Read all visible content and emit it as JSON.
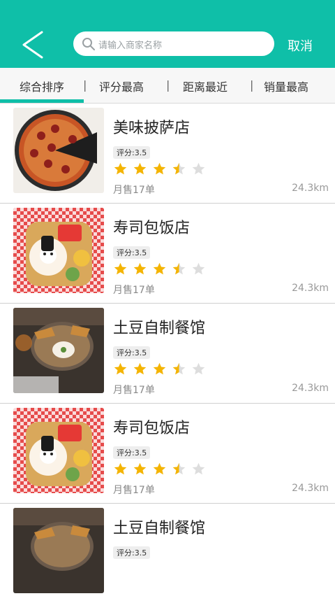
{
  "header": {
    "search_placeholder": "请输入商家名称",
    "cancel_label": "取消",
    "accent": "#0fbfa8"
  },
  "tabs": [
    {
      "label": "综合排序",
      "active": true
    },
    {
      "label": "评分最高",
      "active": false
    },
    {
      "label": "距离最近",
      "active": false
    },
    {
      "label": "销量最高",
      "active": false
    }
  ],
  "list": [
    {
      "name": "美味披萨店",
      "rating": "评分:3.5",
      "stars": 3.5,
      "sales": "月售17单",
      "distance": "24.3km",
      "image": "pizza"
    },
    {
      "name": "寿司包饭店",
      "rating": "评分:3.5",
      "stars": 3.5,
      "sales": "月售17单",
      "distance": "24.3km",
      "image": "bento"
    },
    {
      "name": "土豆自制餐馆",
      "rating": "评分:3.5",
      "stars": 3.5,
      "sales": "月售17单",
      "distance": "24.3km",
      "image": "chips"
    },
    {
      "name": "寿司包饭店",
      "rating": "评分:3.5",
      "stars": 3.5,
      "sales": "月售17单",
      "distance": "24.3km",
      "image": "bento"
    },
    {
      "name": "土豆自制餐馆",
      "rating": "评分:3.5",
      "stars": null,
      "sales": null,
      "distance": null,
      "image": "chips"
    }
  ],
  "icons": {
    "back": "back-chevron-icon",
    "search": "search-icon",
    "star": "star-icon"
  }
}
